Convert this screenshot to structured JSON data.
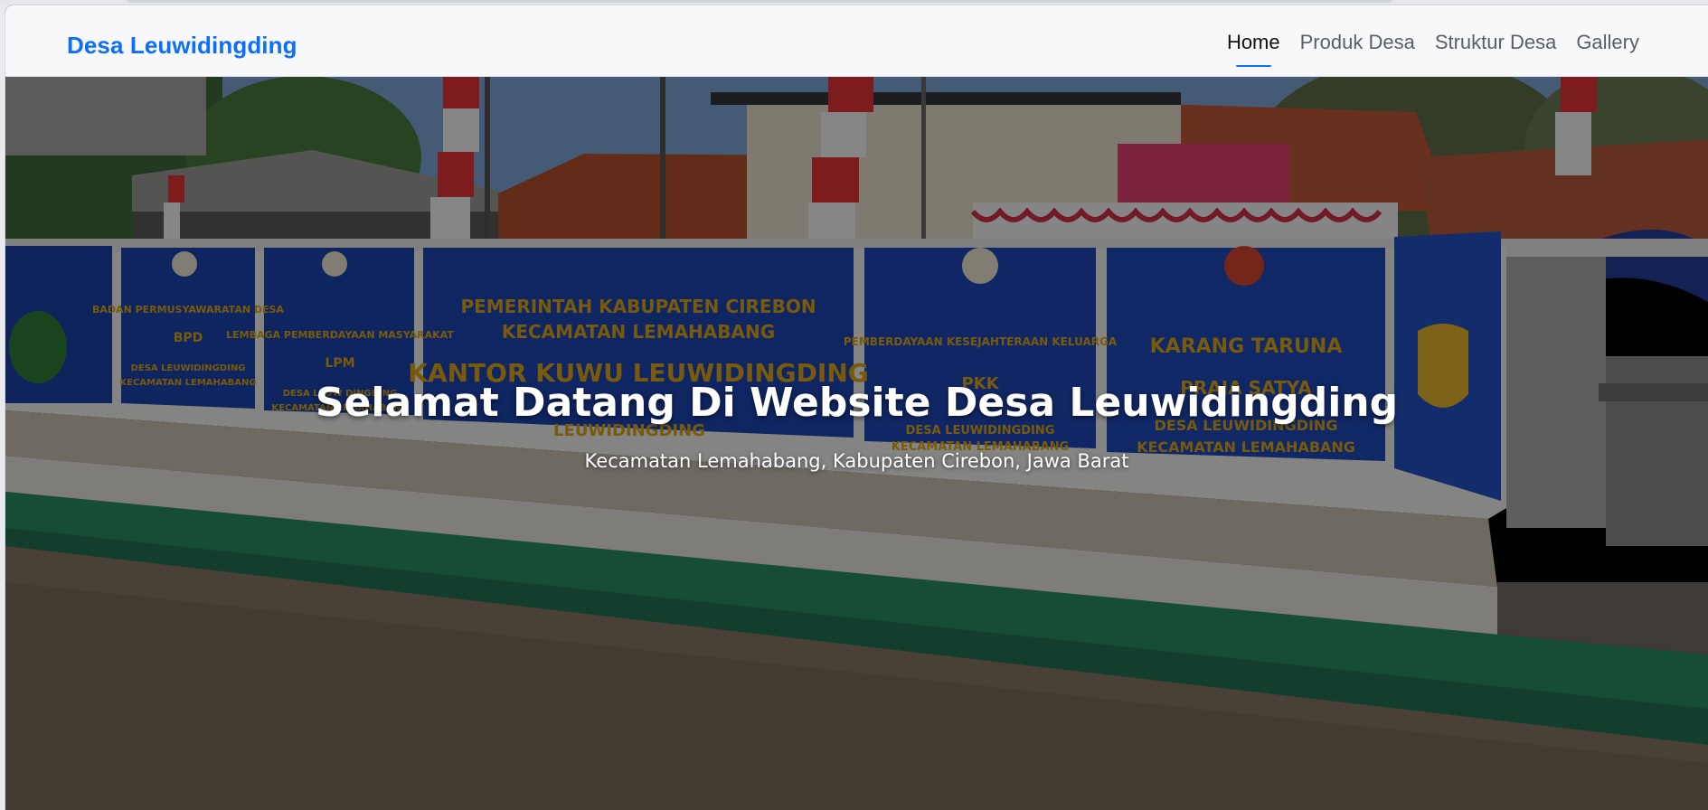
{
  "brand": "Desa Leuwidingding",
  "nav": {
    "items": [
      {
        "label": "Home",
        "active": true
      },
      {
        "label": "Produk Desa",
        "active": false
      },
      {
        "label": "Struktur Desa",
        "active": false
      },
      {
        "label": "Gallery",
        "active": false
      }
    ]
  },
  "hero": {
    "title": "Selamat Datang Di Website Desa Leuwidingding",
    "subtitle": "Kecamatan Lemahabang, Kabupaten Cirebon, Jawa Barat",
    "background": "photo of village office wall with signboards",
    "overlay_color": "#000000"
  },
  "wall_panels": [
    {
      "lines": [
        "BADAN PERMUSYAWARATAN DESA",
        "BPD",
        "DESA LEUWIDINGDING",
        "KECAMATAN LEMAHABANG"
      ]
    },
    {
      "lines": [
        "LEMBAGA PEMBERDAYAAN MASYARAKAT",
        "LPM",
        "DESA LEUW DINGDING",
        "KECAMATAN LEMAHABANG"
      ]
    },
    {
      "lines": [
        "PEMERINTAH KABUPATEN CIREBON",
        "KECAMATAN LEMAHABANG",
        "KANTOR KUWU LEUWIDINGDING",
        "LEUWIDINGDING"
      ]
    },
    {
      "lines": [
        "PEMBERDAYAAN KESEJAHTERAAN KELUARGA",
        "PKK",
        "DESA LEUWIDINGDING",
        "KECAMATAN LEMAHABANG"
      ]
    },
    {
      "lines": [
        "KARANG TARUNA",
        "PRAJA SATYA",
        "DESA LEUWIDINGDING",
        "KECAMATAN LEMAHABANG"
      ]
    }
  ],
  "colors": {
    "brand": "#0d6efd",
    "nav_active_underline": "#0d6efd",
    "wall_blue": "#1a3fa8",
    "panel_lettering": "#d9a514"
  }
}
